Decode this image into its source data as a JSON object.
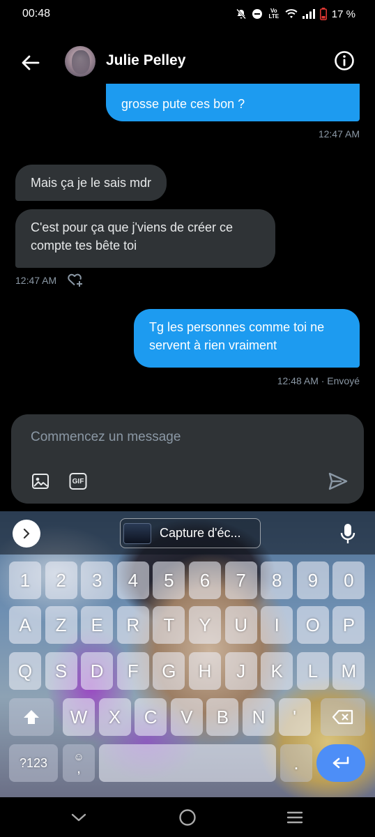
{
  "status_bar": {
    "time": "00:48",
    "volte": "VoLTE",
    "battery_percent": "17 %"
  },
  "header": {
    "contact_name": "Julie Pelley",
    "icons": {
      "back": "back-arrow-icon",
      "info": "info-icon"
    }
  },
  "messages": [
    {
      "type": "sent",
      "lines": [
        "grosse pute ces bon ?"
      ],
      "clipped_top": true
    },
    {
      "type": "meta",
      "text": "12:47 AM"
    },
    {
      "type": "received",
      "text": "Mais ça je le sais mdr"
    },
    {
      "type": "received",
      "lines": [
        "C'est pour ça que j'viens de créer ce",
        "compte tes bête toi"
      ]
    },
    {
      "type": "meta",
      "text": "12:47 AM"
    },
    {
      "type": "sent",
      "lines": [
        "Tg les personnes comme toi ne",
        "servent à rien vraiment"
      ]
    },
    {
      "type": "meta",
      "text": "12:48 AM · Envoyé"
    }
  ],
  "composer": {
    "placeholder": "Commencez un message",
    "gif_label": "GIF"
  },
  "keyboard": {
    "clipboard_suggestion": "Capture d'éc...",
    "row_numbers": [
      "1",
      "2",
      "3",
      "4",
      "5",
      "6",
      "7",
      "8",
      "9",
      "0"
    ],
    "row_1": [
      "A",
      "Z",
      "E",
      "R",
      "T",
      "Y",
      "U",
      "I",
      "O",
      "P"
    ],
    "row_2": [
      "Q",
      "S",
      "D",
      "F",
      "G",
      "H",
      "J",
      "K",
      "L",
      "M"
    ],
    "row_3": [
      "W",
      "X",
      "C",
      "V",
      "B",
      "N",
      "'"
    ],
    "symbols_key": "?123",
    "comma_key": ",",
    "period_key": "."
  },
  "colors": {
    "sent_bubble": "#1d9bf0",
    "received_bubble": "#2f3336",
    "meta_text": "#8b98a5",
    "enter_key": "#4d8ef7"
  }
}
